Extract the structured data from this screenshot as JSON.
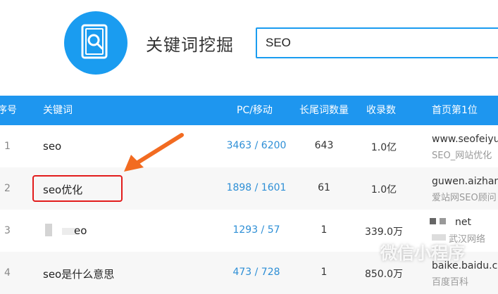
{
  "header": {
    "title": "关键词挖掘",
    "search_value": "SEO",
    "accent_color": "#1a9cf0",
    "logo_icon": "document-search-icon"
  },
  "table": {
    "header_color": "#1e96ef",
    "columns": [
      "序号",
      "关键词",
      "PC/移动",
      "长尾词数量",
      "收录数",
      "首页第1位"
    ],
    "rows": [
      {
        "index": "1",
        "keyword": "seo",
        "pc_mobile": "3463 / 6200",
        "long_tail": "643",
        "indexed": "1.0亿",
        "top1_domain": "www.seofeiyu.c",
        "top1_title": "SEO_网站优化"
      },
      {
        "index": "2",
        "keyword": "seo优化",
        "pc_mobile": "1898 / 1601",
        "long_tail": "61",
        "indexed": "1.0亿",
        "top1_domain": "guwen.aizhan.c",
        "top1_title": "爱站网SEO顾问"
      },
      {
        "index": "3",
        "keyword": "eo",
        "pc_mobile": "1293 / 57",
        "long_tail": "1",
        "indexed": "339.0万",
        "top1_domain": "net",
        "top1_title": "武汉网络"
      },
      {
        "index": "4",
        "keyword": "seo是什么意思",
        "pc_mobile": "473 / 728",
        "long_tail": "1",
        "indexed": "850.0万",
        "top1_domain": "baike.baidu.com",
        "top1_title": "百度百科"
      }
    ]
  },
  "annotation": {
    "highlight_color": "#e21c1c",
    "arrow_color": "#f26b21"
  },
  "watermark": "微信小程序"
}
